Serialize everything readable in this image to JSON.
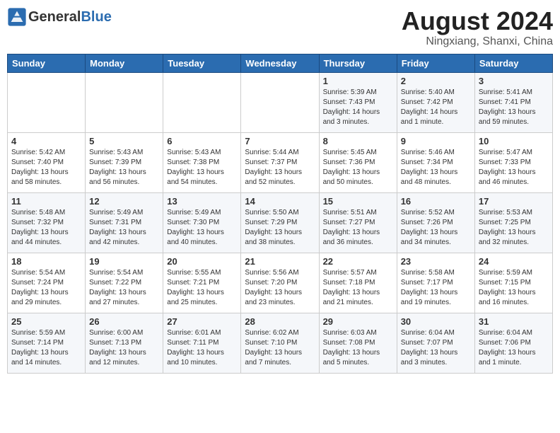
{
  "header": {
    "logo_general": "General",
    "logo_blue": "Blue",
    "title": "August 2024",
    "subtitle": "Ningxiang, Shanxi, China"
  },
  "columns": [
    "Sunday",
    "Monday",
    "Tuesday",
    "Wednesday",
    "Thursday",
    "Friday",
    "Saturday"
  ],
  "weeks": [
    [
      {
        "day": "",
        "info": ""
      },
      {
        "day": "",
        "info": ""
      },
      {
        "day": "",
        "info": ""
      },
      {
        "day": "",
        "info": ""
      },
      {
        "day": "1",
        "info": "Sunrise: 5:39 AM\nSunset: 7:43 PM\nDaylight: 14 hours\nand 3 minutes."
      },
      {
        "day": "2",
        "info": "Sunrise: 5:40 AM\nSunset: 7:42 PM\nDaylight: 14 hours\nand 1 minute."
      },
      {
        "day": "3",
        "info": "Sunrise: 5:41 AM\nSunset: 7:41 PM\nDaylight: 13 hours\nand 59 minutes."
      }
    ],
    [
      {
        "day": "4",
        "info": "Sunrise: 5:42 AM\nSunset: 7:40 PM\nDaylight: 13 hours\nand 58 minutes."
      },
      {
        "day": "5",
        "info": "Sunrise: 5:43 AM\nSunset: 7:39 PM\nDaylight: 13 hours\nand 56 minutes."
      },
      {
        "day": "6",
        "info": "Sunrise: 5:43 AM\nSunset: 7:38 PM\nDaylight: 13 hours\nand 54 minutes."
      },
      {
        "day": "7",
        "info": "Sunrise: 5:44 AM\nSunset: 7:37 PM\nDaylight: 13 hours\nand 52 minutes."
      },
      {
        "day": "8",
        "info": "Sunrise: 5:45 AM\nSunset: 7:36 PM\nDaylight: 13 hours\nand 50 minutes."
      },
      {
        "day": "9",
        "info": "Sunrise: 5:46 AM\nSunset: 7:34 PM\nDaylight: 13 hours\nand 48 minutes."
      },
      {
        "day": "10",
        "info": "Sunrise: 5:47 AM\nSunset: 7:33 PM\nDaylight: 13 hours\nand 46 minutes."
      }
    ],
    [
      {
        "day": "11",
        "info": "Sunrise: 5:48 AM\nSunset: 7:32 PM\nDaylight: 13 hours\nand 44 minutes."
      },
      {
        "day": "12",
        "info": "Sunrise: 5:49 AM\nSunset: 7:31 PM\nDaylight: 13 hours\nand 42 minutes."
      },
      {
        "day": "13",
        "info": "Sunrise: 5:49 AM\nSunset: 7:30 PM\nDaylight: 13 hours\nand 40 minutes."
      },
      {
        "day": "14",
        "info": "Sunrise: 5:50 AM\nSunset: 7:29 PM\nDaylight: 13 hours\nand 38 minutes."
      },
      {
        "day": "15",
        "info": "Sunrise: 5:51 AM\nSunset: 7:27 PM\nDaylight: 13 hours\nand 36 minutes."
      },
      {
        "day": "16",
        "info": "Sunrise: 5:52 AM\nSunset: 7:26 PM\nDaylight: 13 hours\nand 34 minutes."
      },
      {
        "day": "17",
        "info": "Sunrise: 5:53 AM\nSunset: 7:25 PM\nDaylight: 13 hours\nand 32 minutes."
      }
    ],
    [
      {
        "day": "18",
        "info": "Sunrise: 5:54 AM\nSunset: 7:24 PM\nDaylight: 13 hours\nand 29 minutes."
      },
      {
        "day": "19",
        "info": "Sunrise: 5:54 AM\nSunset: 7:22 PM\nDaylight: 13 hours\nand 27 minutes."
      },
      {
        "day": "20",
        "info": "Sunrise: 5:55 AM\nSunset: 7:21 PM\nDaylight: 13 hours\nand 25 minutes."
      },
      {
        "day": "21",
        "info": "Sunrise: 5:56 AM\nSunset: 7:20 PM\nDaylight: 13 hours\nand 23 minutes."
      },
      {
        "day": "22",
        "info": "Sunrise: 5:57 AM\nSunset: 7:18 PM\nDaylight: 13 hours\nand 21 minutes."
      },
      {
        "day": "23",
        "info": "Sunrise: 5:58 AM\nSunset: 7:17 PM\nDaylight: 13 hours\nand 19 minutes."
      },
      {
        "day": "24",
        "info": "Sunrise: 5:59 AM\nSunset: 7:15 PM\nDaylight: 13 hours\nand 16 minutes."
      }
    ],
    [
      {
        "day": "25",
        "info": "Sunrise: 5:59 AM\nSunset: 7:14 PM\nDaylight: 13 hours\nand 14 minutes."
      },
      {
        "day": "26",
        "info": "Sunrise: 6:00 AM\nSunset: 7:13 PM\nDaylight: 13 hours\nand 12 minutes."
      },
      {
        "day": "27",
        "info": "Sunrise: 6:01 AM\nSunset: 7:11 PM\nDaylight: 13 hours\nand 10 minutes."
      },
      {
        "day": "28",
        "info": "Sunrise: 6:02 AM\nSunset: 7:10 PM\nDaylight: 13 hours\nand 7 minutes."
      },
      {
        "day": "29",
        "info": "Sunrise: 6:03 AM\nSunset: 7:08 PM\nDaylight: 13 hours\nand 5 minutes."
      },
      {
        "day": "30",
        "info": "Sunrise: 6:04 AM\nSunset: 7:07 PM\nDaylight: 13 hours\nand 3 minutes."
      },
      {
        "day": "31",
        "info": "Sunrise: 6:04 AM\nSunset: 7:06 PM\nDaylight: 13 hours\nand 1 minute."
      }
    ]
  ]
}
